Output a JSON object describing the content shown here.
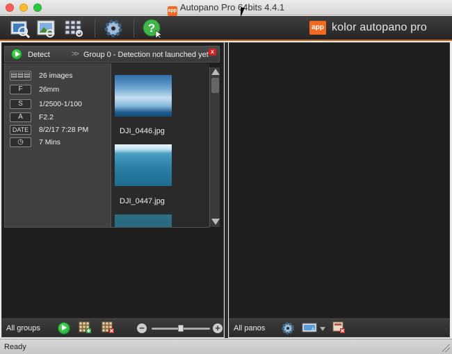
{
  "window": {
    "title": "Autopano Pro 64bits 4.4.1",
    "title_badge": "app"
  },
  "toolbar": {
    "buttons": [
      {
        "icon": "select-images-icon"
      },
      {
        "icon": "import-image-icon"
      },
      {
        "icon": "detection-grid-icon"
      },
      {
        "icon": "settings-gear-icon"
      },
      {
        "icon": "help-icon"
      }
    ],
    "brand_logo": "app",
    "brand_name": "kolor autopano pro"
  },
  "group": {
    "detect_label": "Detect",
    "arrows": ">>",
    "title": "Group 0 - Detection not launched yet",
    "close": "x",
    "info": [
      {
        "key": "▤▤▤",
        "value": "26 images"
      },
      {
        "key": "F",
        "value": "26mm"
      },
      {
        "key": "S",
        "value": "1/2500-1/100"
      },
      {
        "key": "A",
        "value": "F2.2"
      },
      {
        "key": "DATE",
        "value": "8/2/17 7:28 PM"
      },
      {
        "key": "◷",
        "value": "7 Mins"
      }
    ],
    "images": [
      {
        "filename": "DJI_0446.jpg"
      },
      {
        "filename": "DJI_0447.jpg"
      },
      {
        "filename": ""
      }
    ]
  },
  "left_bottom": {
    "label": "All groups",
    "zoom_minus": "−",
    "zoom_plus": "+",
    "zoom_level": 0.5
  },
  "right_bottom": {
    "label": "All panos"
  },
  "status": {
    "text": "Ready"
  },
  "colors": {
    "accent": "#f26a22",
    "play_green": "#22b33a",
    "close_red": "#d02424"
  }
}
